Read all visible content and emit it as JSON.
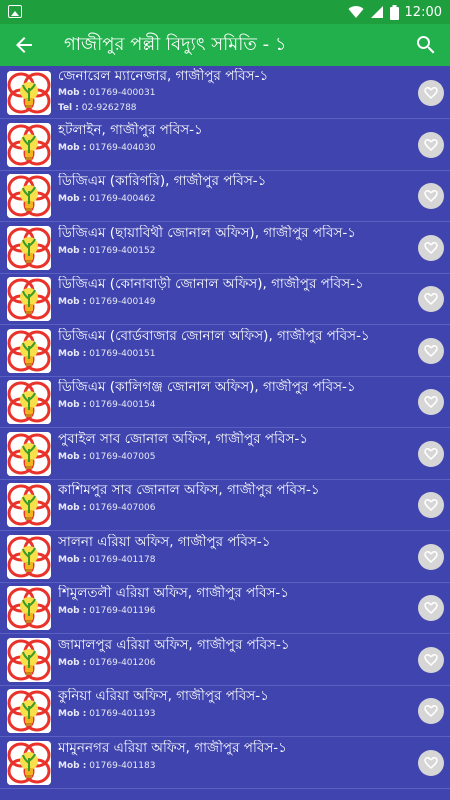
{
  "status_bar": {
    "time": "12:00"
  },
  "app_bar": {
    "title": "গাজীপুর পল্লী বিদ্যুৎ সমিতি - ১"
  },
  "labels": {
    "mob": "Mob :",
    "tel": "Tel :"
  },
  "items": [
    {
      "name": "জেনারেল ম্যানেজার, গাজীপুর পবিস-১",
      "mob": "01769-400031",
      "tel": "02-9262788"
    },
    {
      "name": "হটলাইন, গাজীপুর পবিস-১",
      "mob": "01769-404030"
    },
    {
      "name": "ডিজিএম (কারিগরি), গাজীপুর পবিস-১",
      "mob": "01769-400462"
    },
    {
      "name": "ডিজিএম (ছায়াবিথী জোনাল অফিস), গাজীপুর পবিস-১",
      "mob": "01769-400152"
    },
    {
      "name": "ডিজিএম (কোনাবাড়ী জোনাল অফিস), গাজীপুর পবিস-১",
      "mob": "01769-400149"
    },
    {
      "name": "ডিজিএম (বোর্ডবাজার জোনাল অফিস), গাজীপুর পবিস-১",
      "mob": "01769-400151"
    },
    {
      "name": "ডিজিএম (কালিগঞ্জ জোনাল অফিস), গাজীপুর পবিস-১",
      "mob": "01769-400154"
    },
    {
      "name": "পুবাইল সাব জোনাল অফিস, গাজীপুর পবিস-১",
      "mob": "01769-407005"
    },
    {
      "name": "কাশিমপুর সাব জোনাল অফিস, গাজীপুর পবিস-১",
      "mob": "01769-407006"
    },
    {
      "name": "সালনা এরিয়া অফিস, গাজীপুর পবিস-১",
      "mob": "01769-401178"
    },
    {
      "name": "শিমুলতলী এরিয়া অফিস, গাজীপুর পবিস-১",
      "mob": "01769-401196"
    },
    {
      "name": "জামালপুর এরিয়া অফিস, গাজীপুর পবিস-১",
      "mob": "01769-401206"
    },
    {
      "name": "কুনিয়া এরিয়া অফিস, গাজীপুর পবিস-১",
      "mob": "01769-401193"
    },
    {
      "name": "মামুননগর এরিয়া অফিস, গাজীপুর পবিস-১",
      "mob": "01769-401183"
    }
  ]
}
